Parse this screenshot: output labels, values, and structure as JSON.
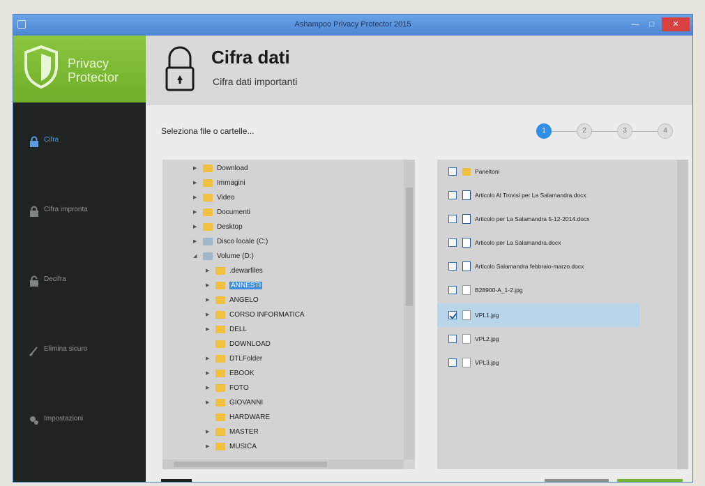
{
  "window": {
    "title": "Ashampoo Privacy Protector 2015"
  },
  "logo": {
    "line1": "Privacy",
    "line2": "Protector"
  },
  "sidebar": {
    "items": [
      {
        "label": "Cifra",
        "icon": "lock-icon",
        "active": true
      },
      {
        "label": "Cifra impronta",
        "icon": "lock-icon",
        "active": false
      },
      {
        "label": "Decifra",
        "icon": "unlock-icon",
        "active": false
      },
      {
        "label": "Elimina sicuro",
        "icon": "shredder-icon",
        "active": false
      },
      {
        "label": "Impostazioni",
        "icon": "settings-icon",
        "active": false
      }
    ]
  },
  "header": {
    "title": "Cifra dati",
    "subtitle": "Cifra dati importanti"
  },
  "main": {
    "instruction": "Seleziona file o cartelle...",
    "steps": [
      "1",
      "2",
      "3",
      "4"
    ],
    "active_step": 1
  },
  "tree": [
    {
      "label": "Download",
      "level": 1,
      "icon": "folder-icon"
    },
    {
      "label": "Immagini",
      "level": 1,
      "icon": "folder-icon"
    },
    {
      "label": "Video",
      "level": 1,
      "icon": "folder-icon"
    },
    {
      "label": "Documenti",
      "level": 1,
      "icon": "folder-icon"
    },
    {
      "label": "Desktop",
      "level": 1,
      "icon": "folder-icon"
    },
    {
      "label": "Disco locale (C:)",
      "level": 1,
      "icon": "drive-icon"
    },
    {
      "label": "Volume (D:)",
      "level": 1,
      "icon": "drive-icon",
      "expanded": true
    },
    {
      "label": ".dewarfiles",
      "level": 2,
      "icon": "folder-icon"
    },
    {
      "label": "ANNESTI",
      "level": 2,
      "icon": "folder-icon",
      "selected": true
    },
    {
      "label": "ANGELO",
      "level": 2,
      "icon": "folder-icon"
    },
    {
      "label": "CORSO INFORMATICA",
      "level": 2,
      "icon": "folder-icon"
    },
    {
      "label": "DELL",
      "level": 2,
      "icon": "folder-icon"
    },
    {
      "label": "DOWNLOAD",
      "level": 2,
      "icon": "folder-icon"
    },
    {
      "label": "DTLFolder",
      "level": 2,
      "icon": "folder-icon"
    },
    {
      "label": "EBOOK",
      "level": 2,
      "icon": "folder-icon"
    },
    {
      "label": "FOTO",
      "level": 2,
      "icon": "folder-icon"
    },
    {
      "label": "GIOVANNI",
      "level": 2,
      "icon": "folder-icon"
    },
    {
      "label": "HARDWARE",
      "level": 2,
      "icon": "folder-icon"
    },
    {
      "label": "MASTER",
      "level": 2,
      "icon": "folder-icon"
    },
    {
      "label": "MUSICA",
      "level": 2,
      "icon": "folder-icon"
    }
  ],
  "files": [
    {
      "label": "Paneltoni",
      "type": "folder",
      "checked": false
    },
    {
      "label": "Articolo Al Trovisi per La Salamandra.docx",
      "type": "doc",
      "checked": false
    },
    {
      "label": "Articolo per La Salamandra 5-12-2014.docx",
      "type": "doc",
      "checked": false
    },
    {
      "label": "Articolo per La Salamandra.docx",
      "type": "doc",
      "checked": false
    },
    {
      "label": "Articolo Salamandra febbraio-marzo.docx",
      "type": "doc",
      "checked": false
    },
    {
      "label": "B28900-A_1-2.jpg",
      "type": "image",
      "checked": false
    },
    {
      "label": "VPL1.jpg",
      "type": "image",
      "checked": true
    },
    {
      "label": "VPL2.jpg",
      "type": "image",
      "checked": false
    },
    {
      "label": "VPL3.jpg",
      "type": "image",
      "checked": false
    }
  ],
  "colors": {
    "accent_green": "#8cc63f",
    "sidebar_bg": "#1f2422",
    "step_active": "#2f8ee6",
    "selection": "#b9d5e9"
  }
}
